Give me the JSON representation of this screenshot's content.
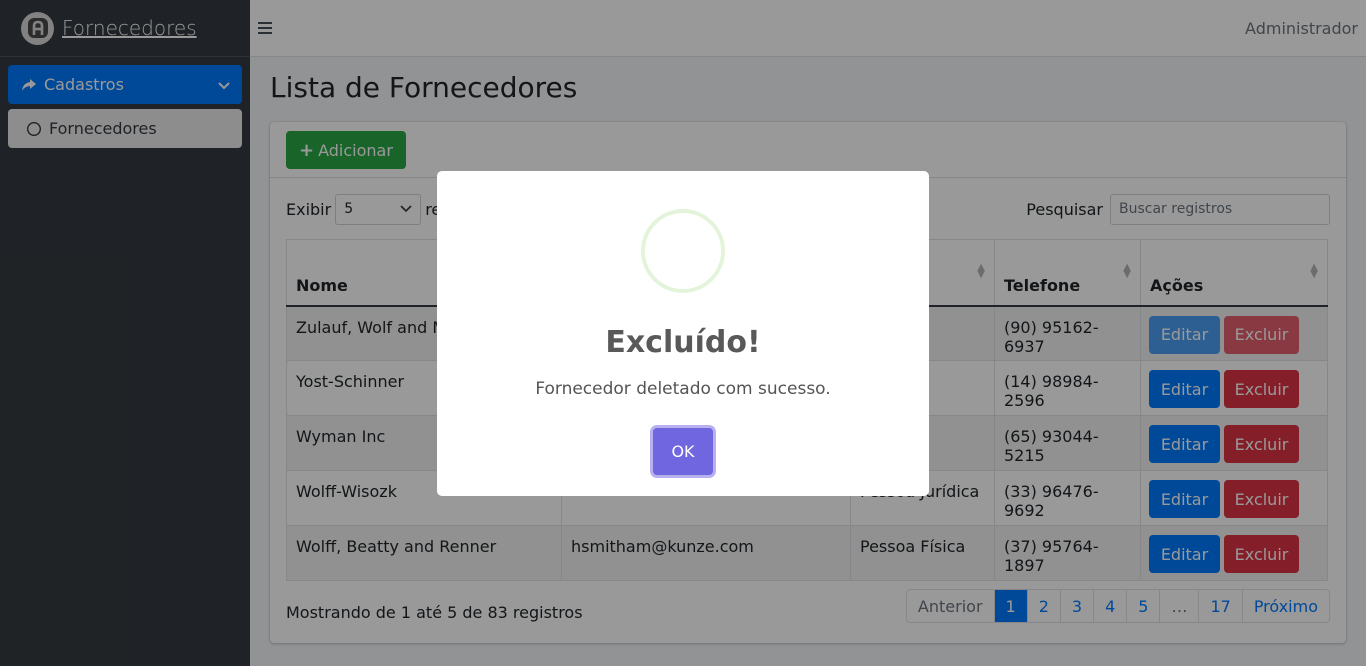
{
  "brand": {
    "title": "Fornecedores",
    "logo_icon": "shield-logo-icon"
  },
  "sidebar": {
    "items": [
      {
        "label": "Cadastros",
        "icon": "share-arrow-icon",
        "expanded": true
      },
      {
        "label": "Fornecedores",
        "icon": "circle-outline-icon"
      }
    ]
  },
  "topbar": {
    "user": "Administrador"
  },
  "page": {
    "title": "Lista de Fornecedores"
  },
  "toolbar": {
    "add_label": "Adicionar"
  },
  "table_controls": {
    "show_label": "Exibir",
    "page_size": "5",
    "records_label": "re",
    "search_label": "Pesquisar",
    "search_placeholder": "Buscar registros"
  },
  "table": {
    "headers": [
      "Nome",
      "",
      "",
      "Telefone",
      "Ações"
    ],
    "rows": [
      {
        "name": "Zulauf, Wolf and M",
        "email": "",
        "type": "urídica",
        "phone": "(90) 95162-6937"
      },
      {
        "name": "Yost-Schinner",
        "email": "",
        "type": "urídica",
        "phone": "(14) 98984-2596"
      },
      {
        "name": "Wyman Inc",
        "email": "",
        "type": "urídica",
        "phone": "(65) 93044-5215"
      },
      {
        "name": "Wolff-Wisozk",
        "email": "",
        "type": "Pessoa Jurídica",
        "phone": "(33) 96476-9692"
      },
      {
        "name": "Wolff, Beatty and Renner",
        "email": "hsmitham@kunze.com",
        "type": "Pessoa Física",
        "phone": "(37) 95764-1897"
      }
    ],
    "edit_label": "Editar",
    "delete_label": "Excluir"
  },
  "footer": {
    "info": "Mostrando de 1 até 5 de 83 registros"
  },
  "pagination": {
    "prev": "Anterior",
    "pages": [
      "1",
      "2",
      "3",
      "4",
      "5",
      "…",
      "17"
    ],
    "next": "Próximo",
    "active": "1"
  },
  "modal": {
    "title": "Excluído!",
    "text": "Fornecedor deletado com sucesso.",
    "ok_label": "OK",
    "icon": "success-icon"
  },
  "colors": {
    "primary": "#007bff",
    "success": "#28a745",
    "danger": "#dc3545",
    "sidebar": "#343a40",
    "modal_button": "#7066e0"
  }
}
